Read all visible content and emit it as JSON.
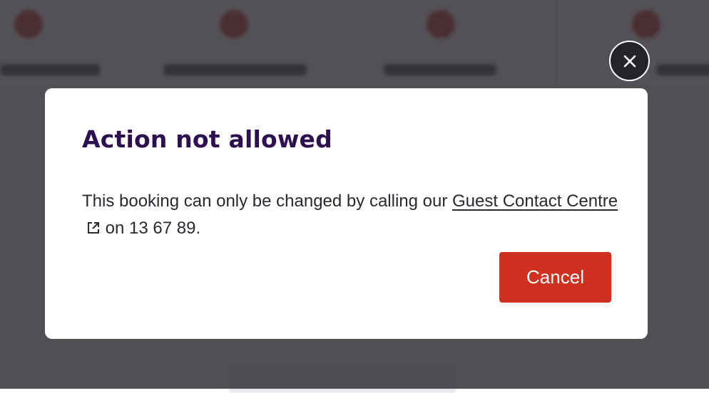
{
  "modal": {
    "title": "Action not allowed",
    "body_text": "This booking can only be changed by calling our",
    "link_text": "Guest Contact Centre",
    "body_suffix": "on 13 67 89.",
    "cancel_label": "Cancel"
  },
  "icons": {
    "close": "close-icon",
    "external_link": "external-link-icon"
  },
  "colors": {
    "title": "#2e0f4f",
    "cancel_button": "#d0301f",
    "overlay": "#28262c"
  }
}
